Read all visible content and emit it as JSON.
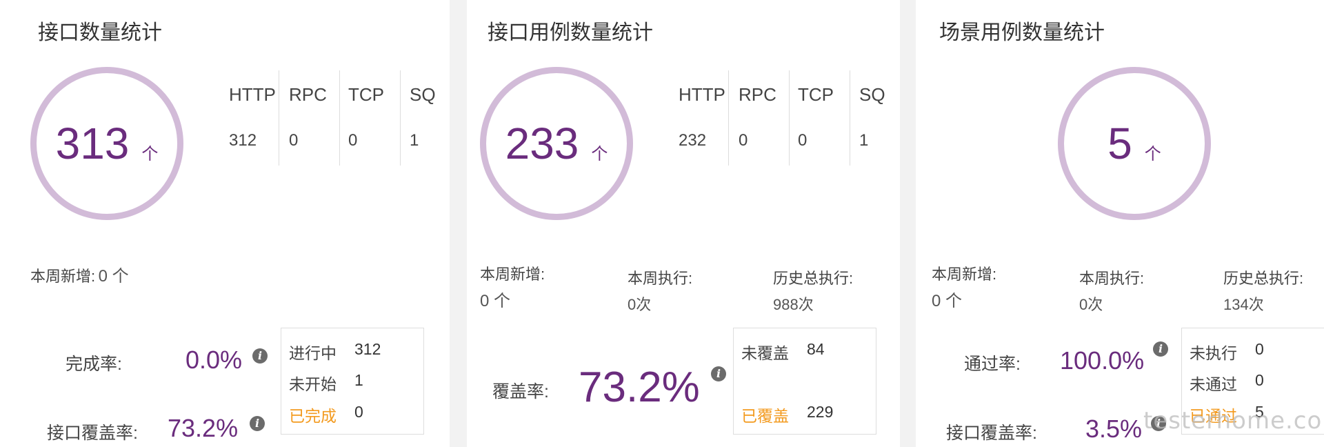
{
  "panels": [
    {
      "title": "接口数量统计",
      "total": "313",
      "unit": "个",
      "protocols": [
        {
          "name": "HTTP",
          "value": "312"
        },
        {
          "name": "RPC",
          "value": "0"
        },
        {
          "name": "TCP",
          "value": "0"
        },
        {
          "name": "SQ",
          "value": "1"
        }
      ],
      "weekly_new": {
        "label": "本周新增:",
        "value": "0 个"
      },
      "rates": [
        {
          "label": "完成率:",
          "value": "0.0%"
        },
        {
          "label": "接口覆盖率:",
          "value": "73.2%"
        }
      ],
      "legend": [
        {
          "label": "进行中",
          "value": "312"
        },
        {
          "label": "未开始",
          "value": "1"
        },
        {
          "label": "已完成",
          "value": "0"
        }
      ]
    },
    {
      "title": "接口用例数量统计",
      "total": "233",
      "unit": "个",
      "protocols": [
        {
          "name": "HTTP",
          "value": "232"
        },
        {
          "name": "RPC",
          "value": "0"
        },
        {
          "name": "TCP",
          "value": "0"
        },
        {
          "name": "SQ",
          "value": "1"
        }
      ],
      "weekly_new": {
        "label": "本周新增:",
        "value": "0 个"
      },
      "weekly_exec": {
        "label": "本周执行:",
        "value": "0次"
      },
      "history_exec": {
        "label": "历史总执行:",
        "value": "988次"
      },
      "rates": [
        {
          "label": "覆盖率:",
          "value": "73.2%"
        }
      ],
      "legend": [
        {
          "label": "未覆盖",
          "value": "84"
        },
        {
          "label": "已覆盖",
          "value": "229"
        }
      ]
    },
    {
      "title": "场景用例数量统计",
      "total": "5",
      "unit": "个",
      "weekly_new": {
        "label": "本周新增:",
        "value": "0 个"
      },
      "weekly_exec": {
        "label": "本周执行:",
        "value": "0次"
      },
      "history_exec": {
        "label": "历史总执行:",
        "value": "134次"
      },
      "rates": [
        {
          "label": "通过率:",
          "value": "100.0%"
        },
        {
          "label": "接口覆盖率:",
          "value": "3.5%"
        }
      ],
      "legend": [
        {
          "label": "未执行",
          "value": "0"
        },
        {
          "label": "未通过",
          "value": "0"
        },
        {
          "label": "已通过",
          "value": "5"
        }
      ]
    }
  ],
  "info_glyph": "i",
  "watermark": "testerhome.com",
  "colors": {
    "accent": "#6a2c7d",
    "ring": "#d2bbd8",
    "passed": "#f39a1e"
  }
}
